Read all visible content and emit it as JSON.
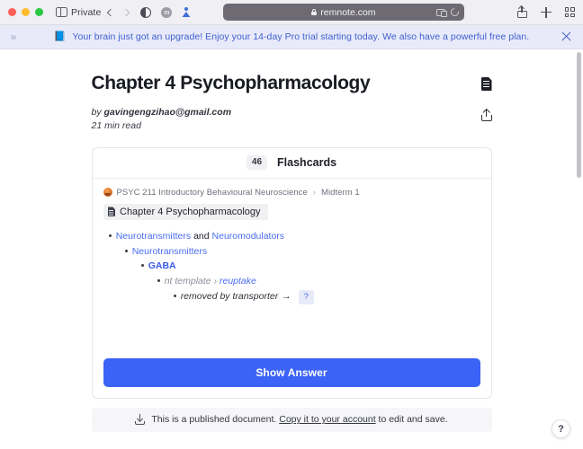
{
  "browser": {
    "private_label": "Private",
    "url": "remnote.com",
    "icons": {
      "sidebar": "sidebar-toggle-icon",
      "back": "back-chevron-icon",
      "forward": "forward-chevron-icon",
      "reader": "reader-mode-icon",
      "extension": "extension-icon",
      "profile": "profile-icon",
      "lock": "lock-icon",
      "page_settings": "page-settings-icon",
      "reload": "reload-icon",
      "share": "share-icon",
      "new_tab": "new-tab-icon",
      "tab_overview": "tab-overview-icon"
    }
  },
  "banner": {
    "expand_glyph": "»",
    "emoji": "📘",
    "text": "Your brain just got an upgrade! Enjoy your 14-day Pro trial starting today. We also have a powerful free plan.",
    "close_label": "close-banner"
  },
  "document": {
    "title": "Chapter 4 Psychopharmacology",
    "by_word": "by",
    "author": "gavingengzihao@gmail.com",
    "read_time": "21 min read"
  },
  "flashcard": {
    "count": "46",
    "label": "Flashcards",
    "breadcrumb": {
      "course": "PSYC 211 Introductory Behavioural Neuroscience",
      "separator": "›",
      "section": "Midterm 1"
    },
    "doc_chip": "Chapter 4 Psychopharmacology",
    "tree": [
      {
        "level": 1,
        "parts": [
          {
            "text": "Neurotransmitters",
            "style": "link"
          },
          {
            "text": "and",
            "style": "plain"
          },
          {
            "text": "Neuromodulators",
            "style": "link"
          }
        ]
      },
      {
        "level": 2,
        "parts": [
          {
            "text": "Neurotransmitters",
            "style": "link"
          }
        ]
      },
      {
        "level": 3,
        "parts": [
          {
            "text": "GABA",
            "style": "bold-link"
          }
        ]
      },
      {
        "level": 4,
        "parts": [
          {
            "text": "nt template",
            "style": "italic-gray"
          },
          {
            "text": "›",
            "style": "italic-gray"
          },
          {
            "text": "reuptake",
            "style": "italic-link"
          }
        ]
      },
      {
        "level": 5,
        "parts": [
          {
            "text": "removed by transporter",
            "style": "italic-dark"
          },
          {
            "text": "→",
            "style": "arrow"
          },
          {
            "text": "?",
            "style": "badge"
          }
        ]
      }
    ],
    "show_answer_label": "Show Answer"
  },
  "footer": {
    "icon": "download-icon",
    "text_before": "This is a published document.",
    "link_text": "Copy it to your account",
    "text_after": "to edit and save."
  },
  "help": {
    "label": "?"
  },
  "colors": {
    "accent_blue": "#3b63f6",
    "link_blue": "#4a6cf0",
    "banner_bg": "#e8eaf9",
    "banner_text": "#3f5fd1",
    "footer_bg": "#f6f6f9"
  }
}
